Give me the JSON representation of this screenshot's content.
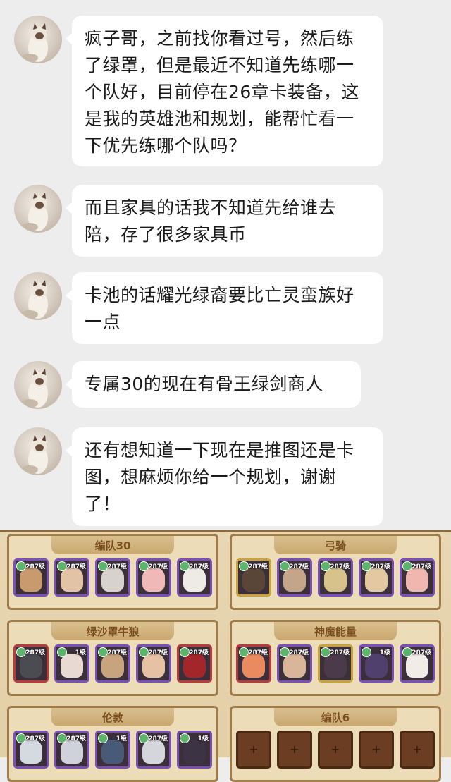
{
  "messages": [
    {
      "text": "疯子哥，之前找你看过号，然后练了绿罩，但是最近不知道先练哪一个队好，目前停在26章卡装备，这是我的英雄池和规划，能帮忙看一下优先练哪个队吗？"
    },
    {
      "text": "而且家具的话我不知道先给谁去陪，存了很多家具币"
    },
    {
      "text": "卡池的话耀光绿裔要比亡灵蛮族好一点"
    },
    {
      "text": "专属30的现在有骨王绿剑商人"
    },
    {
      "text": "还有想知道一下现在是推图还是卡图，想麻烦你给一个规划，谢谢了！"
    }
  ],
  "game": {
    "teams": [
      {
        "name": "编队30",
        "heroes": [
          {
            "level": "287级",
            "frame": "purple",
            "face": "#c89a6e"
          },
          {
            "level": "287级",
            "frame": "purple",
            "face": "#e3c3a6"
          },
          {
            "level": "287级",
            "frame": "purple",
            "face": "#d8d2cc"
          },
          {
            "level": "287级",
            "frame": "purple",
            "face": "#f1b8b8"
          },
          {
            "level": "287级",
            "frame": "purple",
            "face": "#eeeae6"
          }
        ]
      },
      {
        "name": "弓骑",
        "heroes": [
          {
            "level": "287级",
            "frame": "gold",
            "face": "#5a4636"
          },
          {
            "level": "287级",
            "frame": "purple",
            "face": "#c4a58a"
          },
          {
            "level": "287级",
            "frame": "purple",
            "face": "#d6c28a"
          },
          {
            "level": "287级",
            "frame": "purple",
            "face": "#e2c9a2"
          },
          {
            "level": "287级",
            "frame": "purple",
            "face": "#f0b7b0"
          }
        ]
      },
      {
        "name": "绿沙罩牛狼",
        "heroes": [
          {
            "level": "287级",
            "frame": "red",
            "face": "#4b4b52"
          },
          {
            "level": "1级",
            "frame": "purple",
            "face": "#e8d9d2"
          },
          {
            "level": "287级",
            "frame": "purple",
            "face": "#c7a37e"
          },
          {
            "level": "287级",
            "frame": "purple",
            "face": "#e6c1a3"
          },
          {
            "level": "287级",
            "frame": "red",
            "face": "#a3272a"
          }
        ]
      },
      {
        "name": "神魔能量",
        "heroes": [
          {
            "level": "287级",
            "frame": "red",
            "face": "#e98a5f"
          },
          {
            "level": "287级",
            "frame": "purple",
            "face": "#d9b59a"
          },
          {
            "level": "287级",
            "frame": "gold",
            "face": "#4a3a4a"
          },
          {
            "level": "1级",
            "frame": "purple",
            "face": "#50406e"
          },
          {
            "level": "287级",
            "frame": "purple",
            "face": "#f2ece8"
          }
        ]
      },
      {
        "name": "伦敦",
        "heroes": [
          {
            "level": "287级",
            "frame": "purple",
            "face": "#d5d9e0"
          },
          {
            "level": "287级",
            "frame": "purple",
            "face": "#cfd2da"
          },
          {
            "level": "1级",
            "frame": "purple",
            "face": "#495a78"
          },
          {
            "level": "287级",
            "frame": "purple",
            "face": "#d4d6dc"
          },
          {
            "level": "1级",
            "frame": "purple",
            "face": "#3c3344"
          }
        ]
      },
      {
        "name": "编队6",
        "heroes": [
          {
            "empty": true
          },
          {
            "empty": true
          },
          {
            "empty": true
          },
          {
            "empty": true
          },
          {
            "empty": true
          }
        ]
      }
    ]
  }
}
